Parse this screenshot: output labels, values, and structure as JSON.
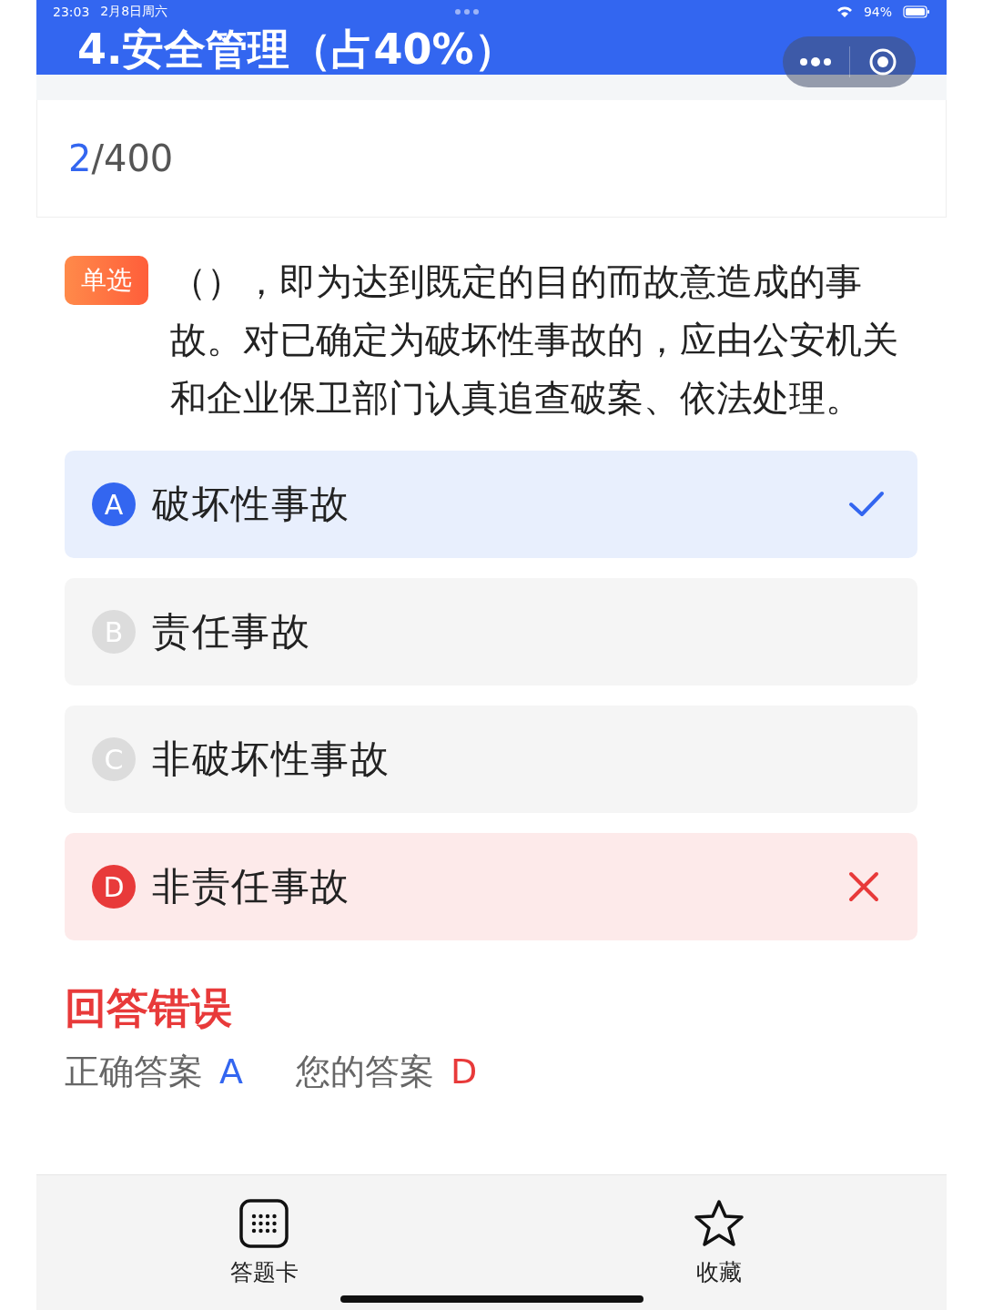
{
  "status_bar": {
    "time": "23:03",
    "date": "2月8日周六",
    "battery": "94%"
  },
  "header": {
    "title": "4.安全管理（占40%）"
  },
  "progress": {
    "current": "2",
    "total": "/400"
  },
  "question": {
    "type_tag": "单选",
    "text": "（），即为达到既定的目的而故意造成的事故。对已确定为破坏性事故的，应由公安机关和企业保卫部门认真追查破案、依法处理。"
  },
  "options": [
    {
      "letter": "A",
      "text": "破坏性事故",
      "correct": true,
      "chosen": false
    },
    {
      "letter": "B",
      "text": "责任事故",
      "correct": false,
      "chosen": false
    },
    {
      "letter": "C",
      "text": "非破坏性事故",
      "correct": false,
      "chosen": false
    },
    {
      "letter": "D",
      "text": "非责任事故",
      "correct": false,
      "chosen": true
    }
  ],
  "result": {
    "verdict": "回答错误",
    "correct_label": "正确答案",
    "correct_value": "A",
    "your_label": "您的答案",
    "your_value": "D"
  },
  "bottom_bar": [
    {
      "label": "答题卡",
      "kind": "grid"
    },
    {
      "label": "收藏",
      "kind": "star"
    }
  ]
}
